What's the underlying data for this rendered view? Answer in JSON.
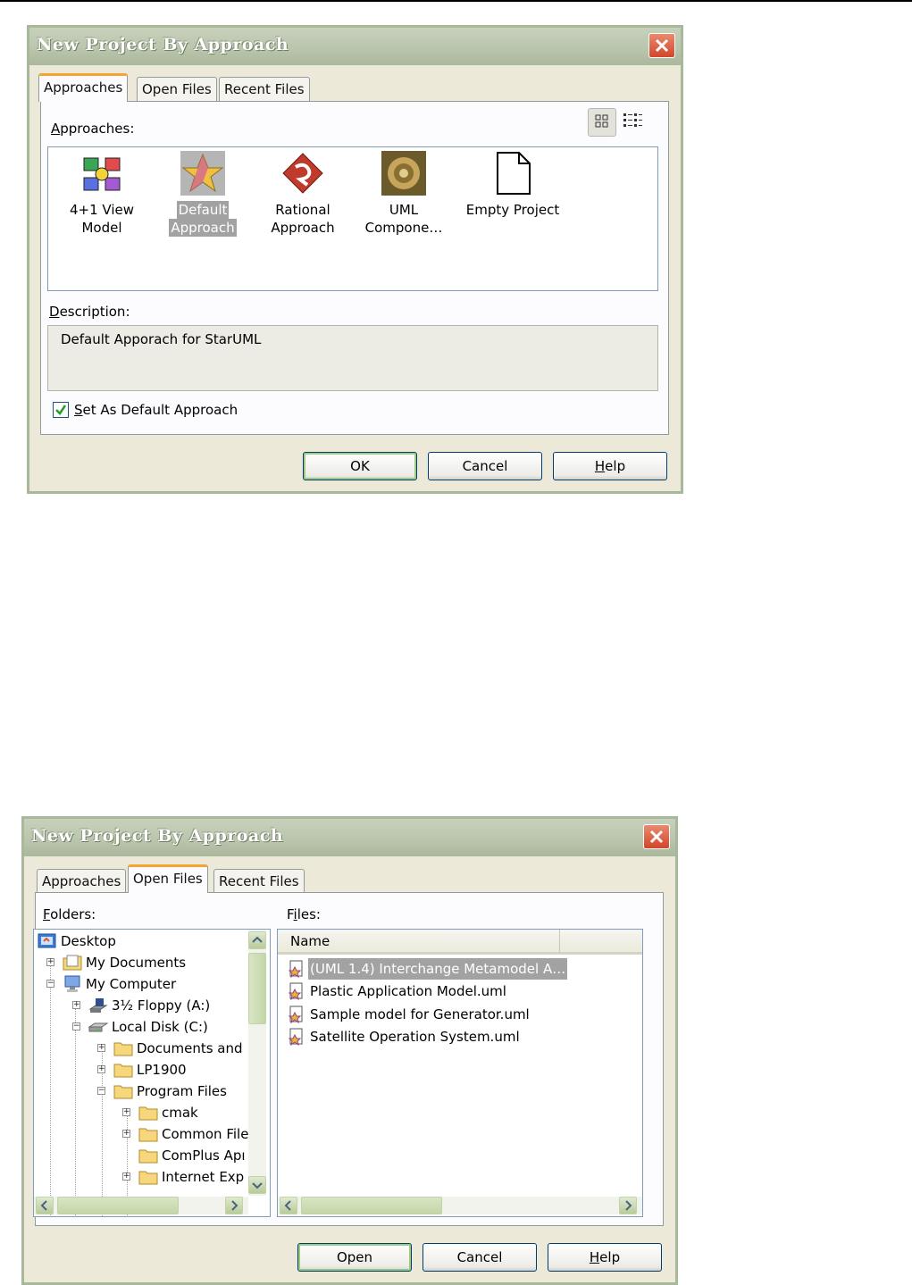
{
  "dialog1": {
    "title": "New Project By Approach",
    "tabs": [
      "Approaches",
      "Open Files",
      "Recent Files"
    ],
    "approaches_label": "Approaches:",
    "approaches": [
      {
        "label_line1": "4+1 View",
        "label_line2": "Model",
        "icon": "four-plus-one-icon"
      },
      {
        "label_line1": "Default",
        "label_line2": "Approach",
        "icon": "star-icon",
        "selected": true
      },
      {
        "label_line1": "Rational",
        "label_line2": "Approach",
        "icon": "rational-icon"
      },
      {
        "label_line1": "UML",
        "label_line2": "Compone…",
        "icon": "component-icon"
      },
      {
        "label_line1": "Empty Project",
        "label_line2": "",
        "icon": "blank-document-icon"
      }
    ],
    "description_label": "Description:",
    "description_text": "Default Apporach for StarUML",
    "set_default_label": "Set As Default Approach",
    "set_default_checked": true,
    "buttons": {
      "ok": "OK",
      "cancel": "Cancel",
      "help": "Help"
    }
  },
  "dialog2": {
    "title": "New Project By Approach",
    "tabs": [
      "Approaches",
      "Open Files",
      "Recent Files"
    ],
    "folders_label": "Folders:",
    "files_label": "Files:",
    "tree": [
      {
        "label": "Desktop",
        "icon": "desktop-icon"
      },
      {
        "label": "My Documents",
        "icon": "my-documents-icon"
      },
      {
        "label": "My Computer",
        "icon": "my-computer-icon"
      },
      {
        "label": "3½ Floppy (A:)",
        "icon": "floppy-drive-icon"
      },
      {
        "label": "Local Disk (C:)",
        "icon": "local-disk-icon"
      },
      {
        "label": "Documents and",
        "icon": "folder-icon"
      },
      {
        "label": "LP1900",
        "icon": "folder-icon"
      },
      {
        "label": "Program Files",
        "icon": "folder-icon"
      },
      {
        "label": "cmak",
        "icon": "folder-icon"
      },
      {
        "label": "Common File",
        "icon": "folder-icon"
      },
      {
        "label": "ComPlus Apı",
        "icon": "folder-icon"
      },
      {
        "label": "Internet Exp",
        "icon": "folder-icon"
      }
    ],
    "files_column": "Name",
    "files": [
      {
        "name": "(UML 1.4) Interchange Metamodel A…",
        "selected": true
      },
      {
        "name": "Plastic Application Model.uml"
      },
      {
        "name": "Sample model for Generator.uml"
      },
      {
        "name": "Satellite Operation System.uml"
      }
    ],
    "buttons": {
      "open": "Open",
      "cancel": "Cancel",
      "help": "Help"
    }
  },
  "colors": {
    "title_bar": "#bcc7af",
    "dialog_bg": "#ece9d8",
    "active_tab_accent": "#f5a431",
    "close_button": "#d2462a",
    "selection": "#a2a2a2"
  }
}
